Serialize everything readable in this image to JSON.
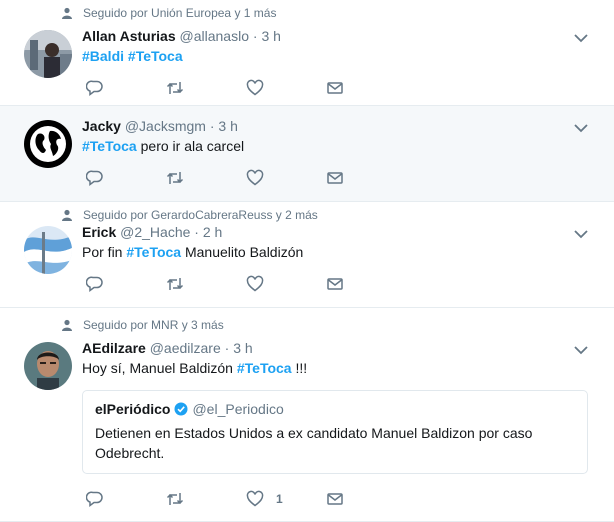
{
  "tweets": [
    {
      "social": "Seguido por Unión Europea y 1 más",
      "name": "Allan Asturias",
      "handle": "@allanaslo",
      "dot": "·",
      "time": "3 h",
      "tag1": "#Baldi",
      "tag2": "#TeToca"
    },
    {
      "name": "Jacky",
      "handle": "@Jacksmgm",
      "dot": "·",
      "time": "3 h",
      "tag": "#TeToca",
      "rest": " pero ir ala carcel"
    },
    {
      "social": "Seguido por GerardoCabreraReuss y 2 más",
      "name": "Erick",
      "handle": "@2_Hache",
      "dot": "·",
      "time": "2 h",
      "pre": "Por fin ",
      "tag": "#TeToca",
      "rest": " Manuelito Baldizón"
    },
    {
      "social": "Seguido por MNR y 3 más",
      "name": "AEdilzare",
      "handle": "@aedilzare",
      "dot": "·",
      "time": "3 h",
      "pre": "Hoy sí, Manuel Baldizón ",
      "tag": "#TeToca",
      "rest": " !!!",
      "like_count": "1",
      "quote": {
        "name": "elPeriódico",
        "handle": "@el_Periodico",
        "text": "Detienen en Estados Unidos a ex candidato Manuel Baldizon por caso Odebrecht."
      }
    }
  ],
  "colors": {
    "link": "#1da1f2",
    "muted": "#657786",
    "border": "#e6ecf0",
    "hover": "#f5f8fa"
  },
  "icons": [
    "person-icon",
    "chevron-down-icon",
    "reply-icon",
    "retweet-icon",
    "like-icon",
    "message-icon",
    "verified-icon"
  ]
}
